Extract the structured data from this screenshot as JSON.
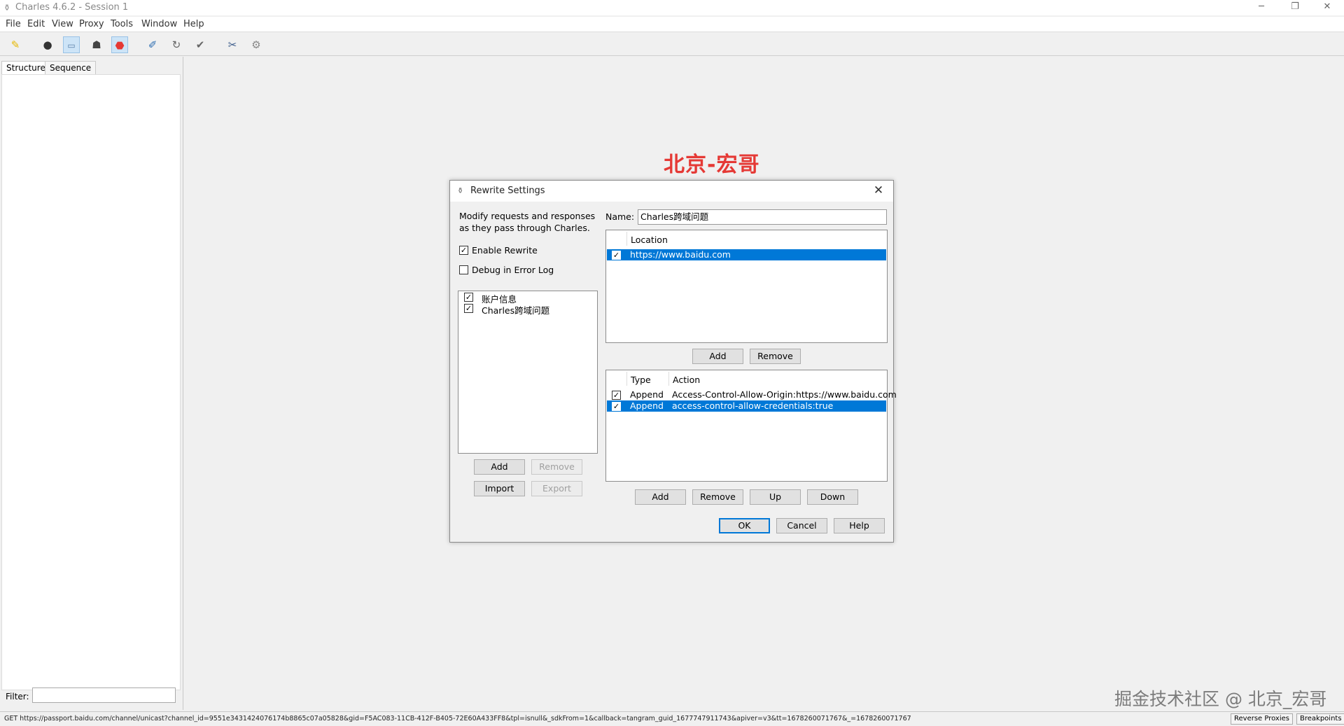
{
  "window": {
    "title": "Charles 4.6.2 - Session 1",
    "minimize_icon": "minimize-icon",
    "restore_icon": "restore-icon",
    "close_icon": "close-icon"
  },
  "menu": [
    "File",
    "Edit",
    "View",
    "Proxy",
    "Tools",
    "Window",
    "Help"
  ],
  "toolbar": {
    "icons": [
      "broom-icon",
      "record-icon",
      "throttle-icon",
      "turtle-icon",
      "breakpoint-icon",
      "compose-icon",
      "repeat-icon",
      "validate-icon",
      "tools-icon",
      "settings-icon"
    ]
  },
  "left_panel": {
    "tabs": [
      "Structure",
      "Sequence"
    ],
    "filter_label": "Filter:"
  },
  "watermark": {
    "top": "北京-宏哥",
    "bottom": "掘金技术社区 @ 北京_宏哥"
  },
  "dialog": {
    "title": "Rewrite Settings",
    "description": "Modify requests and responses as they pass through Charles.",
    "enable_rewrite": {
      "label": "Enable Rewrite",
      "checked": true
    },
    "debug_log": {
      "label": "Debug in Error Log",
      "checked": false
    },
    "rules": [
      {
        "label": "账户信息",
        "checked": true
      },
      {
        "label": "Charles跨域问题",
        "checked": true
      }
    ],
    "rules_buttons": {
      "add": "Add",
      "remove": "Remove",
      "import": "Import",
      "export": "Export"
    },
    "name_label": "Name:",
    "name_value": "Charles跨域问题",
    "location_header": "Location",
    "locations": [
      {
        "value": "https://www.baidu.com",
        "checked": true,
        "selected": true
      }
    ],
    "location_buttons": {
      "add": "Add",
      "remove": "Remove"
    },
    "action_headers": {
      "type": "Type",
      "action": "Action"
    },
    "actions": [
      {
        "type": "Append",
        "action": "Access-Control-Allow-Origin:https://www.baidu.com",
        "checked": true,
        "selected": false
      },
      {
        "type": "Append",
        "action": "access-control-allow-credentials:true",
        "checked": true,
        "selected": true
      }
    ],
    "action_buttons": {
      "add": "Add",
      "remove": "Remove",
      "up": "Up",
      "down": "Down"
    },
    "footer_buttons": {
      "ok": "OK",
      "cancel": "Cancel",
      "help": "Help"
    }
  },
  "statusbar": {
    "text": "GET https://passport.baidu.com/channel/unicast?channel_id=9551e3431424076174b8865c07a05828&gid=F5AC083-11CB-412F-B405-72E60A433FF8&tpl=isnull&_sdkFrom=1&callback=tangram_guid_1677747911743&apiver=v3&tt=1678260071767&_=1678260071767",
    "reverse_proxies": "Reverse Proxies",
    "breakpoints": "Breakpoints"
  }
}
